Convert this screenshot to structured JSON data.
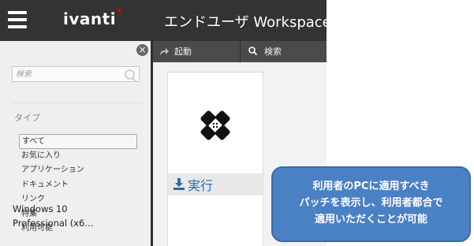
{
  "header": {
    "logo_text": "ivanti",
    "title": "エンドユーザ Workspace"
  },
  "sidebar": {
    "search_placeholder": "検索",
    "type_heading": "タイプ",
    "types": [
      {
        "label": "すべて",
        "selected": true
      },
      {
        "label": "お気に入り",
        "selected": false
      },
      {
        "label": "アプリケーション",
        "selected": false
      },
      {
        "label": "ドキュメント",
        "selected": false
      },
      {
        "label": "リンク",
        "selected": false
      },
      {
        "label": "特集",
        "selected": false
      },
      {
        "label": "利用可能",
        "selected": false
      }
    ]
  },
  "toolbar": {
    "launch_label": "起動",
    "search_label": "検索"
  },
  "card": {
    "run_label": "実行",
    "title_line1": "Windows 10",
    "title_line2": "Professional (x6..."
  },
  "callout": {
    "line1": "利用者のPCに適用すべき",
    "line2": "パッチを表示し、利用者都合で",
    "line3": "適用いただくことが可能"
  },
  "colors": {
    "header_bg": "#333333",
    "toolbar_bg": "#4a4a4a",
    "accent_blue": "#1f6fb5",
    "callout_bg": "#4a81c5",
    "logo_dot": "#d50000"
  }
}
